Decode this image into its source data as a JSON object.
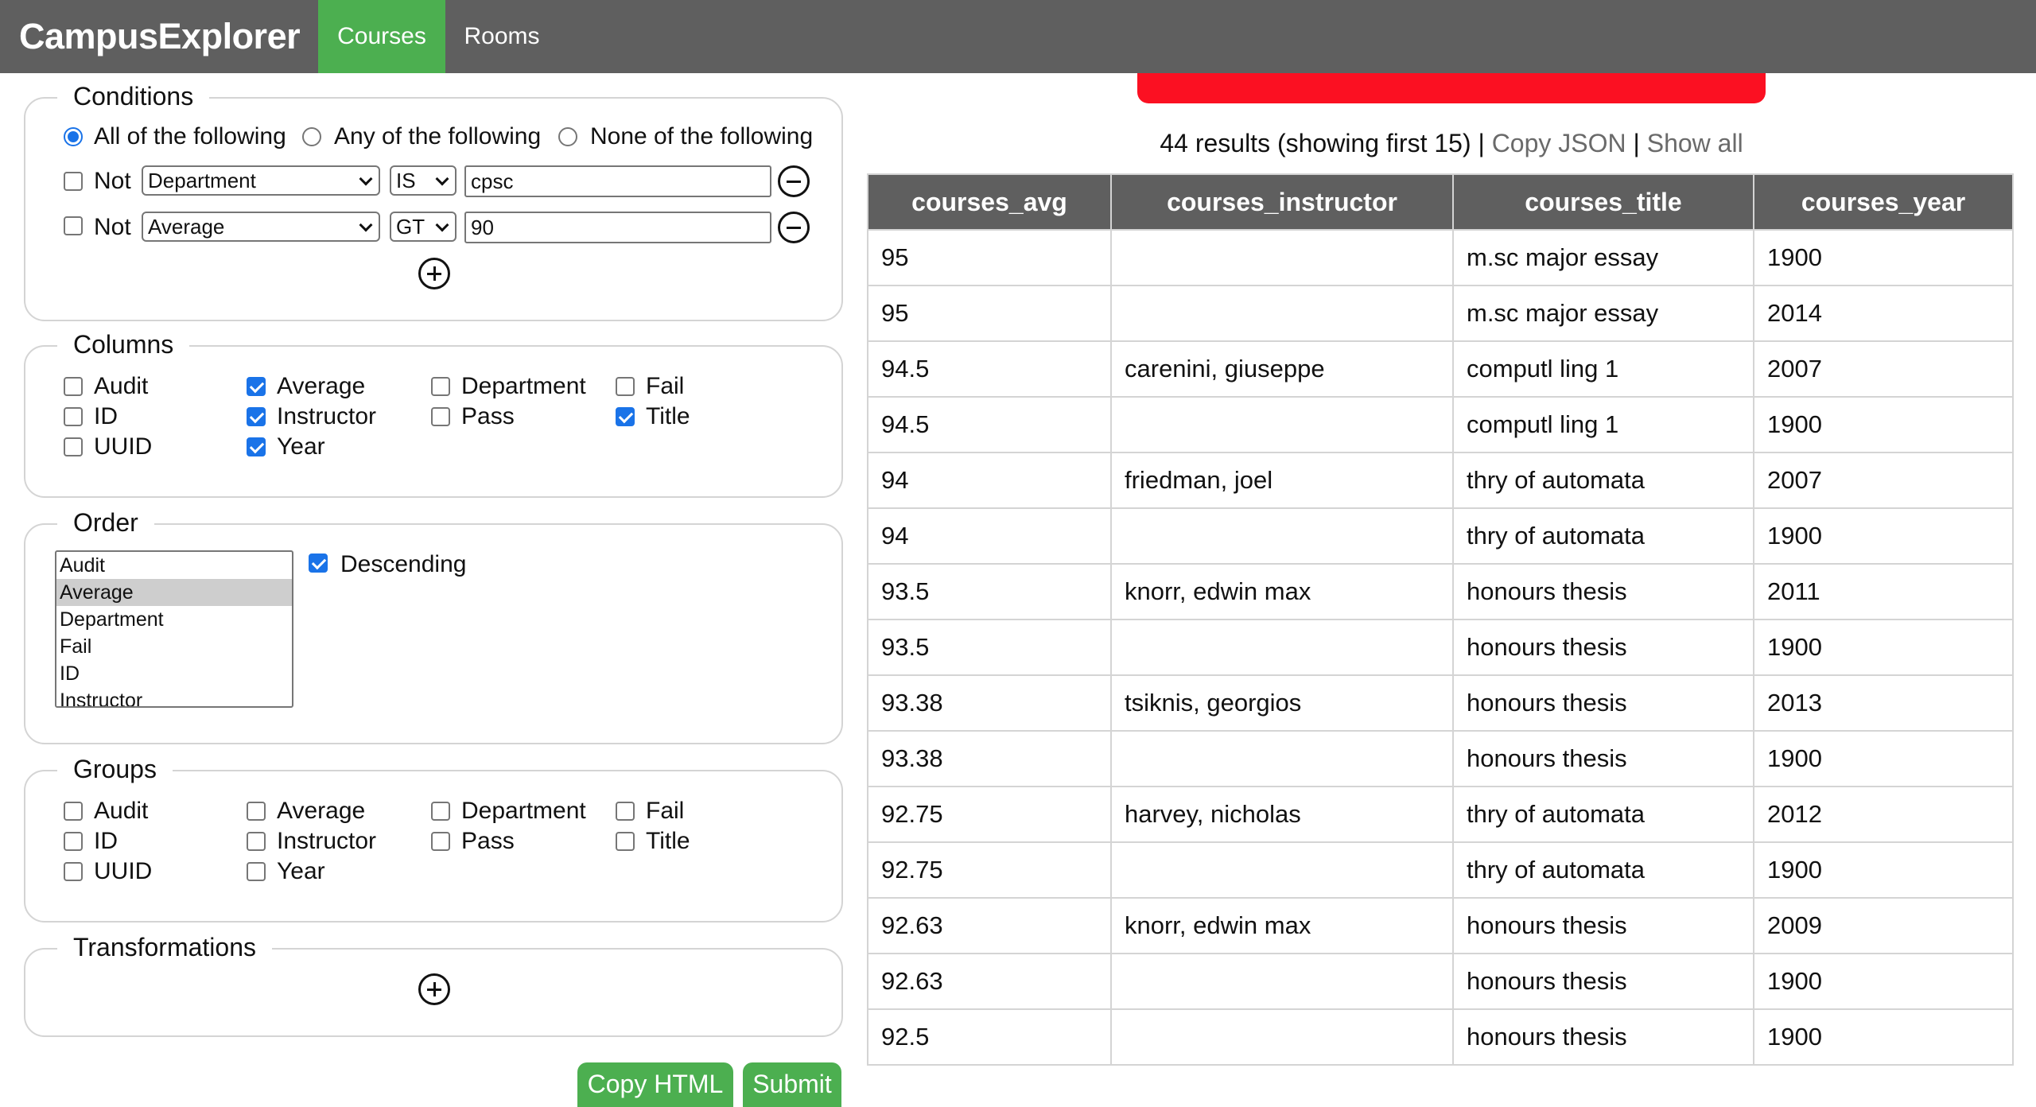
{
  "navbar": {
    "brand": "CampusExplorer",
    "tabs": [
      {
        "label": "Courses",
        "active": true
      },
      {
        "label": "Rooms",
        "active": false
      }
    ]
  },
  "conditions": {
    "legend": "Conditions",
    "modes": [
      {
        "label": "All of the following",
        "selected": true
      },
      {
        "label": "Any of the following",
        "selected": false
      },
      {
        "label": "None of the following",
        "selected": false
      }
    ],
    "rows": [
      {
        "not_label": "Not",
        "not_checked": false,
        "field": "Department",
        "operator": "IS",
        "value": "cpsc"
      },
      {
        "not_label": "Not",
        "not_checked": false,
        "field": "Average",
        "operator": "GT",
        "value": "90"
      }
    ]
  },
  "columns": {
    "legend": "Columns",
    "items": [
      {
        "label": "Audit",
        "checked": false
      },
      {
        "label": "Average",
        "checked": true
      },
      {
        "label": "Department",
        "checked": false
      },
      {
        "label": "Fail",
        "checked": false
      },
      {
        "label": "ID",
        "checked": false
      },
      {
        "label": "Instructor",
        "checked": true
      },
      {
        "label": "Pass",
        "checked": false
      },
      {
        "label": "Title",
        "checked": true
      },
      {
        "label": "UUID",
        "checked": false
      },
      {
        "label": "Year",
        "checked": true
      }
    ]
  },
  "order": {
    "legend": "Order",
    "options": [
      "Audit",
      "Average",
      "Department",
      "Fail",
      "ID",
      "Instructor"
    ],
    "selected": "Average",
    "descending_label": "Descending",
    "descending_checked": true
  },
  "groups": {
    "legend": "Groups",
    "items": [
      {
        "label": "Audit",
        "checked": false
      },
      {
        "label": "Average",
        "checked": false
      },
      {
        "label": "Department",
        "checked": false
      },
      {
        "label": "Fail",
        "checked": false
      },
      {
        "label": "ID",
        "checked": false
      },
      {
        "label": "Instructor",
        "checked": false
      },
      {
        "label": "Pass",
        "checked": false
      },
      {
        "label": "Title",
        "checked": false
      },
      {
        "label": "UUID",
        "checked": false
      },
      {
        "label": "Year",
        "checked": false
      }
    ]
  },
  "transformations": {
    "legend": "Transformations"
  },
  "buttons": {
    "copy_html": "Copy HTML",
    "submit": "Submit"
  },
  "results": {
    "summary": "44 results (showing first 15)",
    "copy_json": "Copy JSON",
    "show_all": "Show all",
    "separator": "|",
    "headers": [
      "courses_avg",
      "courses_instructor",
      "courses_title",
      "courses_year"
    ],
    "rows": [
      [
        "95",
        "",
        "m.sc major essay",
        "1900"
      ],
      [
        "95",
        "",
        "m.sc major essay",
        "2014"
      ],
      [
        "94.5",
        "carenini, giuseppe",
        "computl ling 1",
        "2007"
      ],
      [
        "94.5",
        "",
        "computl ling 1",
        "1900"
      ],
      [
        "94",
        "friedman, joel",
        "thry of automata",
        "2007"
      ],
      [
        "94",
        "",
        "thry of automata",
        "1900"
      ],
      [
        "93.5",
        "knorr, edwin max",
        "honours thesis",
        "2011"
      ],
      [
        "93.5",
        "",
        "honours thesis",
        "1900"
      ],
      [
        "93.38",
        "tsiknis, georgios",
        "honours thesis",
        "2013"
      ],
      [
        "93.38",
        "",
        "honours thesis",
        "1900"
      ],
      [
        "92.75",
        "harvey, nicholas",
        "thry of automata",
        "2012"
      ],
      [
        "92.75",
        "",
        "thry of automata",
        "1900"
      ],
      [
        "92.63",
        "knorr, edwin max",
        "honours thesis",
        "2009"
      ],
      [
        "92.63",
        "",
        "honours thesis",
        "1900"
      ],
      [
        "92.5",
        "",
        "honours thesis",
        "1900"
      ]
    ]
  },
  "colors": {
    "navbar": "#5f5f5f",
    "accent": "#4caf50",
    "alert": "#fb1022",
    "checkbox": "#1a73e8"
  }
}
